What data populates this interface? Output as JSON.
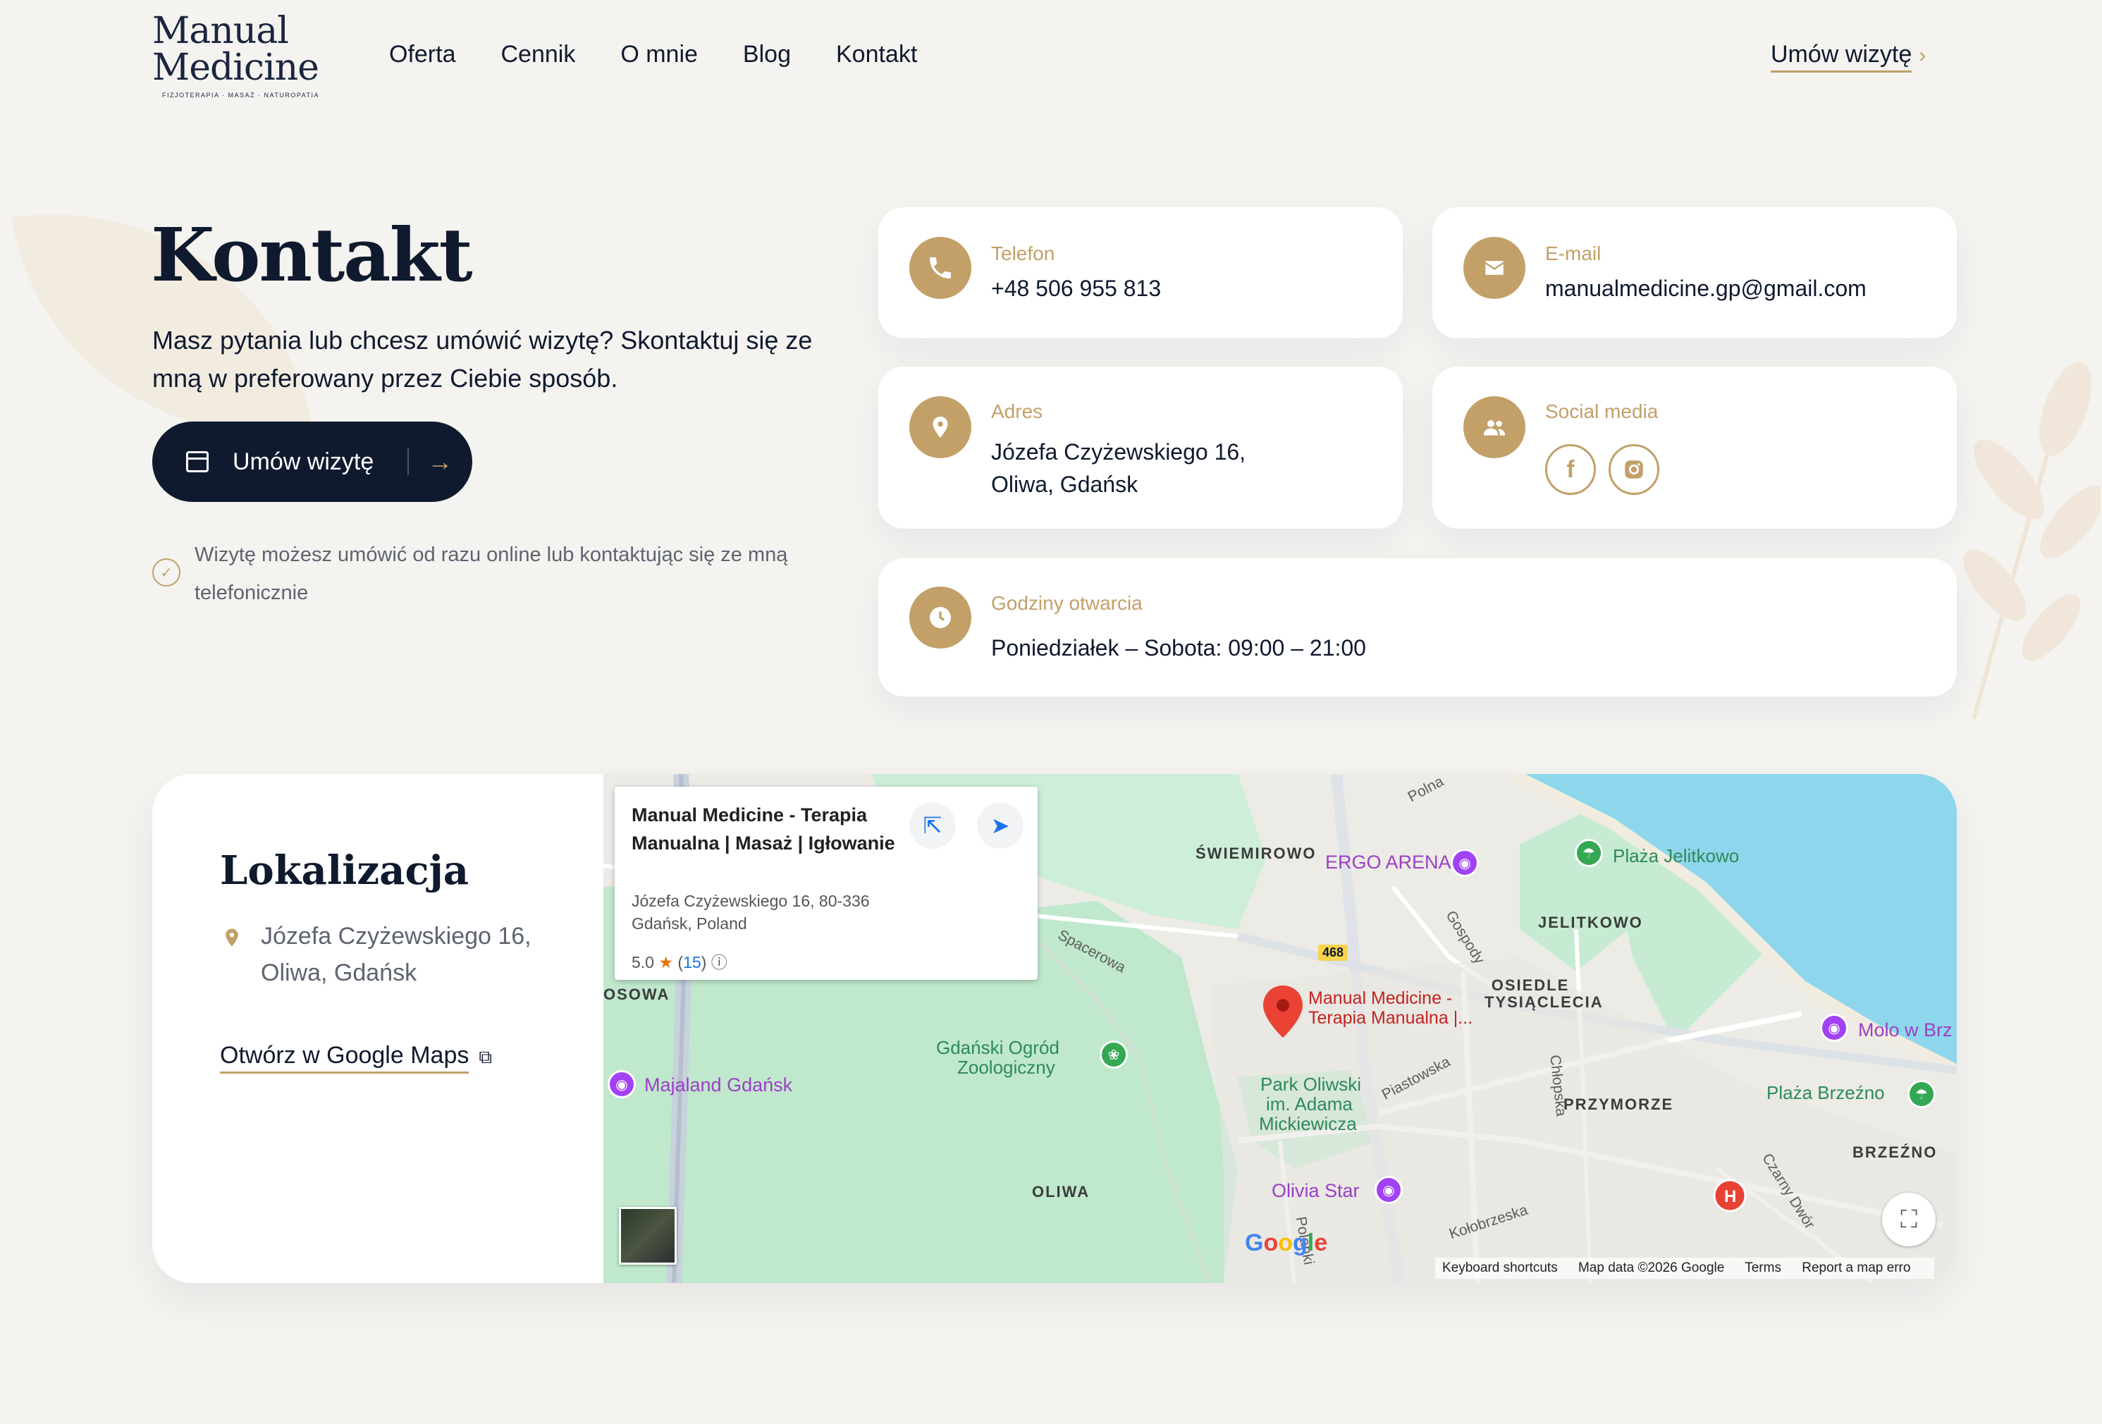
{
  "header": {
    "logo_line1": "Manual",
    "logo_line2": "Medicine",
    "logo_tagline": "FIZJOTERAPIA · MASAŻ · NATUROPATIA",
    "nav": [
      "Oferta",
      "Cennik",
      "O mnie",
      "Blog",
      "Kontakt"
    ],
    "cta_label": "Umów wizytę",
    "cta_chevron": "›"
  },
  "hero": {
    "title": "Kontakt",
    "description": "Masz pytania lub chcesz umówić wizytę? Skontaktuj się ze mną w preferowany przez Ciebie sposób.",
    "button_label": "Umów wizytę",
    "button_arrow": "→",
    "note": "Wizytę możesz umówić od razu online lub kontaktując się ze mną telefonicznie"
  },
  "cards": {
    "phone": {
      "label": "Telefon",
      "value": "+48 506 955 813"
    },
    "email": {
      "label": "E-mail",
      "value": "manualmedicine.gp@gmail.com"
    },
    "address": {
      "label": "Adres",
      "line1": "Józefa Czyżewskiego 16,",
      "line2": "Oliwa, Gdańsk"
    },
    "social": {
      "label": "Social media",
      "facebook": "f"
    },
    "hours": {
      "label": "Godziny otwarcia",
      "value": "Poniedziałek – Sobota: 09:00 – 21:00"
    }
  },
  "location": {
    "title": "Lokalizacja",
    "address_line1": "Józefa Czyżewskiego 16,",
    "address_line2": "Oliwa, Gdańsk",
    "maps_link": "Otwórz w Google Maps"
  },
  "map": {
    "info_title": "Manual Medicine - Terapia Manualna | Masaż | Igłowanie",
    "info_address": "Józefa Czyżewskiego 16, 80-336 Gdańsk, Poland",
    "info_rating": "5.0",
    "info_star": "★",
    "info_reviews": "15",
    "info_icon": "ⓘ",
    "labels": {
      "swiemirowo": "ŚWIEMIROWO",
      "ergo_arena": "ERGO ARENA",
      "plaza_jelitkowo": "Plaża Jelitkowo",
      "jelitkowo": "JELITKOWO",
      "osiedle": "OSIEDLE TYSIĄCLECIA",
      "molo": "Molo w Brz",
      "marker_line1": "Manual Medicine -",
      "marker_line2": "Terapia Manualna |...",
      "zoo_line1": "Gdański Ogród",
      "zoo_line2": "Zoologiczny",
      "majaland": "Majaland Gdańsk",
      "osowa": "OSOWA",
      "park_line1": "Park Oliwski",
      "park_line2": "im. Adama",
      "park_line3": "Mickiewicza",
      "przymorze": "PRZYMORZE",
      "plaza_brzezno": "Plaża Brzeźno",
      "brzezno": "BRZEŹNO",
      "oliwa": "OLIWA",
      "olivia_star": "Olivia Star",
      "spacerowa": "Spacerowa",
      "polna": "Polna",
      "gospody": "Gospody",
      "piastowska": "Piastowska",
      "chlopska": "Chłopska",
      "czarny_dwor": "Czarny Dwór",
      "kolobrzeska": "Kołobrzeska",
      "polanki": "Polanki",
      "road_468": "468"
    },
    "google": "Google",
    "footer": [
      "Keyboard shortcuts",
      "Map data ©2026 Google",
      "Terms",
      "Report a map erro"
    ]
  },
  "colors": {
    "accent": "#c2a068",
    "navy": "#0f1a2e",
    "background": "#f5f3f0",
    "water": "#8ed6ec",
    "park": "#bfe8cc"
  }
}
